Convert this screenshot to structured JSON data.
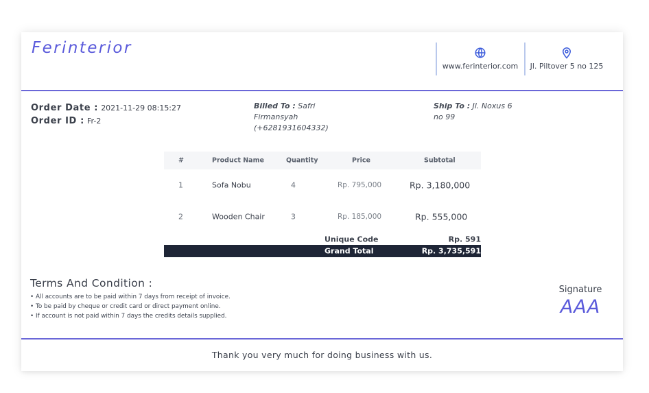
{
  "header": {
    "brand": "Ferinterior",
    "website": "www.ferinterior.com",
    "website_icon": "globe-icon",
    "address": "Jl. Piltover 5 no 125",
    "address_icon": "map-pin-icon"
  },
  "order": {
    "date_label": "Order Date :",
    "date_value": "2021-11-29 08:15:27",
    "id_label": "Order ID :",
    "id_value": "Fr-2"
  },
  "billed": {
    "label": "Billed To :",
    "name_first": "Safri",
    "name_last": "Firmansyah",
    "phone": "(+6281931604332)"
  },
  "ship": {
    "label": "Ship To :",
    "address_line1": "Jl. Noxus 6",
    "address_line2": "no 99"
  },
  "table": {
    "headers": [
      "#",
      "Product Name",
      "Quantity",
      "Price",
      "Subtotal"
    ],
    "rows": [
      {
        "num": "1",
        "name": "Sofa Nobu",
        "qty": "4",
        "price": "Rp. 795,000",
        "subtotal": "Rp. 3,180,000"
      },
      {
        "num": "2",
        "name": "Wooden Chair",
        "qty": "3",
        "price": "Rp. 185,000",
        "subtotal": "Rp. 555,000"
      }
    ],
    "unique_label": "Unique Code",
    "unique_value": "Rp. 591",
    "grand_label": "Grand Total",
    "grand_value": "Rp. 3,735,591"
  },
  "terms": {
    "title": "Terms And Condition :",
    "items": [
      "All accounts are to be paid within 7 days from receipt of invoice.",
      "To be paid by cheque or credit card or direct payment online.",
      "If account is not paid within 7 days the credits details supplied."
    ]
  },
  "signature": {
    "label": "Signature",
    "mark": "AAA"
  },
  "footer": {
    "message": "Thank you very much for doing business with us."
  },
  "colors": {
    "accent": "#5a5adb",
    "rule": "#6a67d8",
    "grand_total_bg": "#1e2536",
    "icon": "#3b5bdb"
  }
}
